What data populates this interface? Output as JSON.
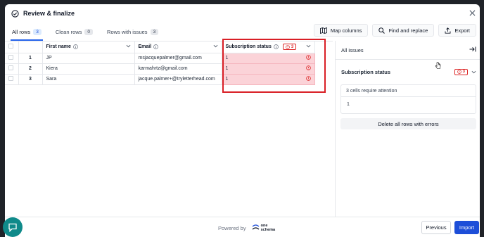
{
  "modal": {
    "title": "Review & finalize",
    "tabs": [
      {
        "label": "All rows",
        "count": "3"
      },
      {
        "label": "Clean rows",
        "count": "0"
      },
      {
        "label": "Rows with issues",
        "count": "3"
      }
    ],
    "toolbar": {
      "map_columns": "Map columns",
      "find_replace": "Find and replace",
      "export": "Export"
    }
  },
  "table": {
    "columns": {
      "first_name": "First name",
      "email": "Email",
      "subscription_status": "Subscription status",
      "subscription_error_count": "3"
    },
    "rows": [
      {
        "index": "1",
        "first_name": "JP",
        "email": "msjacquepalmer@gmail.com",
        "subscription_status": "1"
      },
      {
        "index": "2",
        "first_name": "Kiera",
        "email": "karmahrtz@gmail.com",
        "subscription_status": "1"
      },
      {
        "index": "3",
        "first_name": "Sara",
        "email": "jacque.palmer+@tryletterhead.com",
        "subscription_status": "1"
      }
    ]
  },
  "side_panel": {
    "all_issues": "All issues",
    "column": "Subscription status",
    "error_count": "3",
    "attention_text": "3 cells require attention",
    "value": "1",
    "delete_button": "Delete all rows with errors"
  },
  "footer": {
    "powered_by": "Powered by",
    "logo_line1": "one",
    "logo_line2": "schema",
    "previous": "Previous",
    "import": "Import"
  },
  "colors": {
    "accent": "#1d4ed8",
    "error": "#dc2626",
    "error_cell": "#fbd3d8",
    "highlight_border": "#d91f26",
    "chat_button": "#0f8a8a"
  }
}
